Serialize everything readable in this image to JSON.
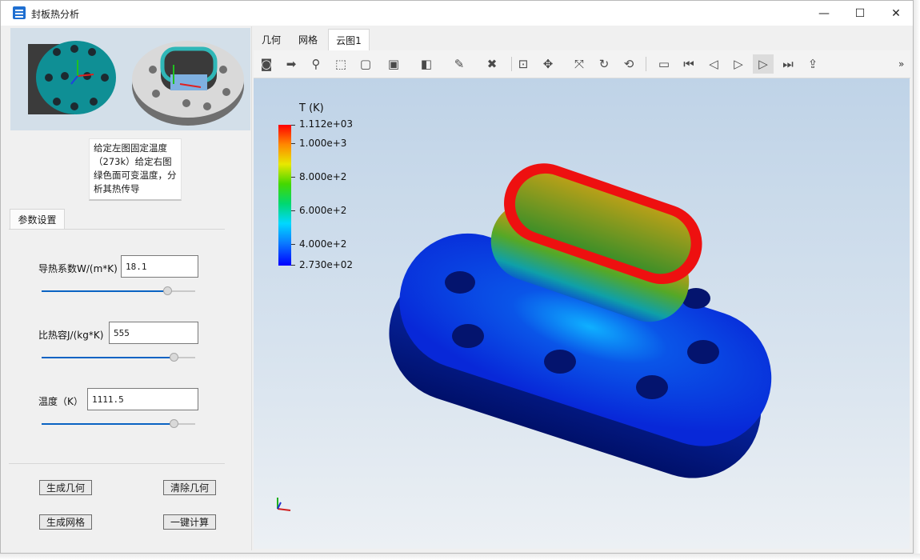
{
  "window": {
    "title": "封板热分析",
    "controls": [
      "—",
      "☐",
      "✕"
    ]
  },
  "left_panel": {
    "description": "给定左图固定温度（273k）给定右图绿色面可变温度，分析其热传导",
    "tab_label": "参数设置",
    "params": [
      {
        "label": "导热系数W/(m*K)",
        "value": "18.1",
        "slider": 0.82
      },
      {
        "label": "比热容J/(kg*K)",
        "value": "555",
        "slider": 0.86
      },
      {
        "label": "温度（K）",
        "value": "1111.5",
        "slider": 0.86
      }
    ],
    "buttons": {
      "gen_geometry": "生成几何",
      "clear_geometry": "清除几何",
      "gen_mesh": "生成网格",
      "compute": "一键计算"
    }
  },
  "viewer": {
    "tabs": [
      "几何",
      "网格",
      "云图1"
    ],
    "active_tab": "云图1",
    "toolbar_icons": [
      "camera-icon",
      "export-icon",
      "zoom-icon",
      "fit-icon",
      "box-icon",
      "display-mode-icon",
      "render-mode-icon",
      "clean-icon",
      "delete-icon",
      "zoom-box-icon",
      "pan-icon",
      "axes-icon",
      "rotate-icon",
      "reset-view-icon",
      "video-icon",
      "first-frame-icon",
      "prev-frame-icon",
      "play-icon",
      "next-frame-icon",
      "last-frame-icon",
      "share-icon"
    ],
    "more": "»",
    "colorbar": {
      "title": "T (K)",
      "labels": [
        "1.112e+03",
        "1.000e+3",
        "8.000e+2",
        "6.000e+2",
        "4.000e+2",
        "2.730e+02"
      ],
      "colors": {
        "max": "#ff0000",
        "mid": "#44d800",
        "min": "#0000ff"
      }
    }
  }
}
